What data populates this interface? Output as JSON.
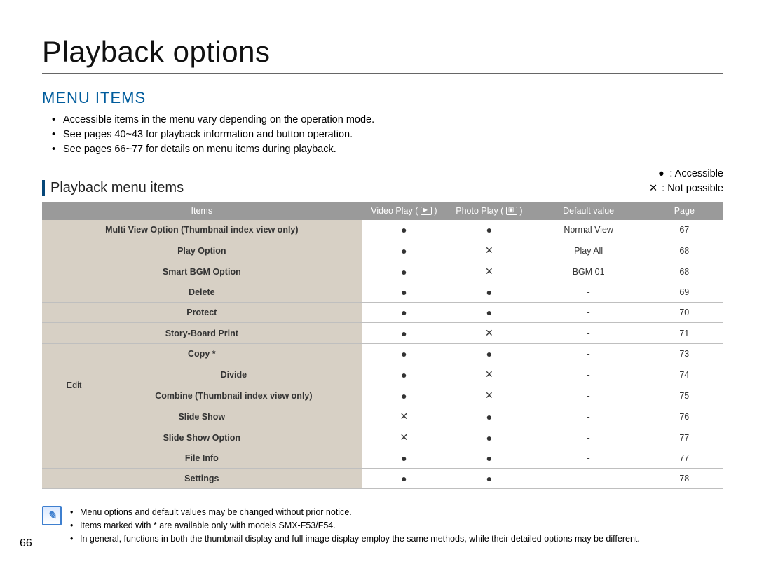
{
  "pageTitle": "Playback options",
  "sectionTitle": "MENU ITEMS",
  "intro": [
    "Accessible items in the menu vary depending on the operation mode.",
    "See pages 40~43 for playback information and button operation.",
    "See pages 66~77 for details on menu items during playback."
  ],
  "subTitle": "Playback menu items",
  "legend": {
    "accessible": {
      "symbol": "●",
      "label": ": Accessible"
    },
    "notPossible": {
      "symbol": "✕",
      "label": ": Not possible"
    }
  },
  "tableHeaders": {
    "items": "Items",
    "video": "Video Play (",
    "videoClose": ")",
    "photo": "Photo Play (",
    "photoClose": ")",
    "default": "Default value",
    "page": "Page"
  },
  "editLabel": "Edit",
  "rows": [
    {
      "item": "Multi View Option (Thumbnail index view only)",
      "video": "●",
      "photo": "●",
      "default": "Normal View",
      "page": "67"
    },
    {
      "item": "Play Option",
      "video": "●",
      "photo": "✕",
      "default": "Play All",
      "page": "68"
    },
    {
      "item": "Smart BGM Option",
      "video": "●",
      "photo": "✕",
      "default": "BGM 01",
      "page": "68"
    },
    {
      "item": "Delete",
      "video": "●",
      "photo": "●",
      "default": "-",
      "page": "69"
    },
    {
      "item": "Protect",
      "video": "●",
      "photo": "●",
      "default": "-",
      "page": "70"
    },
    {
      "item": "Story-Board Print",
      "video": "●",
      "photo": "✕",
      "default": "-",
      "page": "71"
    },
    {
      "item": "Copy *",
      "video": "●",
      "photo": "●",
      "default": "-",
      "page": "73"
    },
    {
      "item": "Divide",
      "video": "●",
      "photo": "✕",
      "default": "-",
      "page": "74",
      "edit": true
    },
    {
      "item": "Combine  (Thumbnail index view only)",
      "video": "●",
      "photo": "✕",
      "default": "-",
      "page": "75",
      "edit": true
    },
    {
      "item": "Slide Show",
      "video": "✕",
      "photo": "●",
      "default": "-",
      "page": "76"
    },
    {
      "item": "Slide Show Option",
      "video": "✕",
      "photo": "●",
      "default": "-",
      "page": "77"
    },
    {
      "item": "File Info",
      "video": "●",
      "photo": "●",
      "default": "-",
      "page": "77"
    },
    {
      "item": "Settings",
      "video": "●",
      "photo": "●",
      "default": "-",
      "page": "78"
    }
  ],
  "notes": [
    "Menu options and default values may be changed without prior notice.",
    "Items marked with * are available only with models SMX-F53/F54.",
    "In general, functions in both the thumbnail display and full image display employ the same methods, while their detailed options may be different."
  ],
  "pageNumber": "66"
}
